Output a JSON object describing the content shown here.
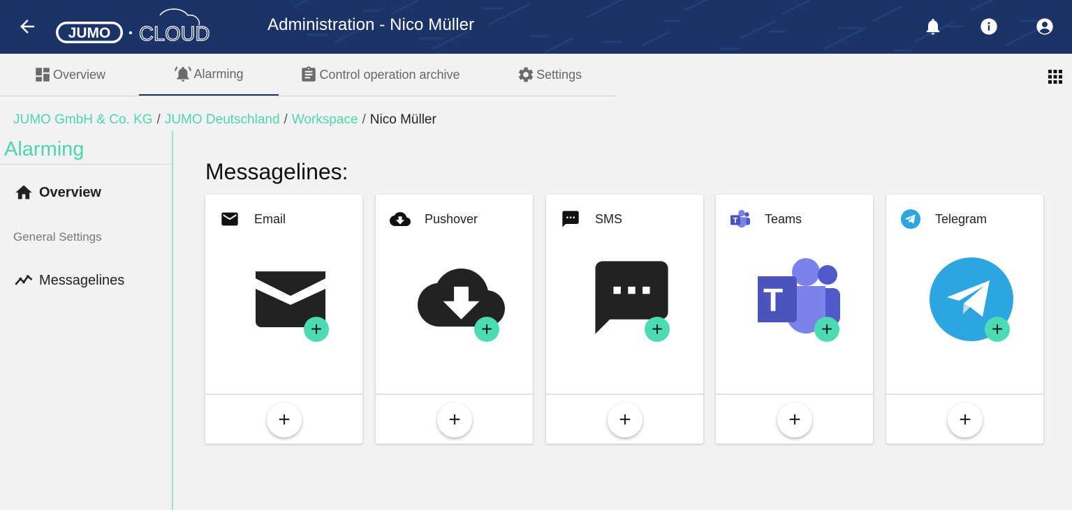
{
  "header": {
    "title": "Administration - Nico Müller",
    "logo_brand": "JUMO",
    "logo_product": "CLOUD",
    "icons": [
      "back-arrow-icon",
      "bell-icon",
      "info-icon",
      "account-icon"
    ],
    "background_color": "#1b3366"
  },
  "tabs": [
    {
      "label": "Overview",
      "icon": "dashboard-icon",
      "active": false
    },
    {
      "label": "Alarming",
      "icon": "alarm-bell-icon",
      "active": true
    },
    {
      "label": "Control operation archive",
      "icon": "clipboard-icon",
      "active": false
    },
    {
      "label": "Settings",
      "icon": "gear-icon",
      "active": false
    }
  ],
  "breadcrumb": {
    "items": [
      "JUMO GmbH & Co. KG",
      "JUMO Deutschland",
      "Workspace",
      "Nico Müller"
    ],
    "separator": "/"
  },
  "sidebar": {
    "heading": "Alarming",
    "items": [
      {
        "label": "Overview",
        "icon": "home-icon",
        "active": true
      },
      {
        "label": "General Settings",
        "icon": "",
        "active": false
      },
      {
        "label": "Messagelines",
        "icon": "trend-line-icon",
        "active": false
      }
    ]
  },
  "main": {
    "title": "Messagelines:",
    "cards": [
      {
        "label": "Email",
        "icon": "email-icon",
        "add_symbol": "+"
      },
      {
        "label": "Pushover",
        "icon": "cloud-download-icon",
        "add_symbol": "+"
      },
      {
        "label": "SMS",
        "icon": "sms-icon",
        "add_symbol": "+"
      },
      {
        "label": "Teams",
        "icon": "teams-icon",
        "add_symbol": "+"
      },
      {
        "label": "Telegram",
        "icon": "telegram-icon",
        "add_symbol": "+"
      }
    ]
  },
  "colors": {
    "accent": "#4cd6b0",
    "badge": "#4cdcb4",
    "header": "#1b3366",
    "teams": "#5059c9",
    "telegram": "#2ca5e0"
  }
}
